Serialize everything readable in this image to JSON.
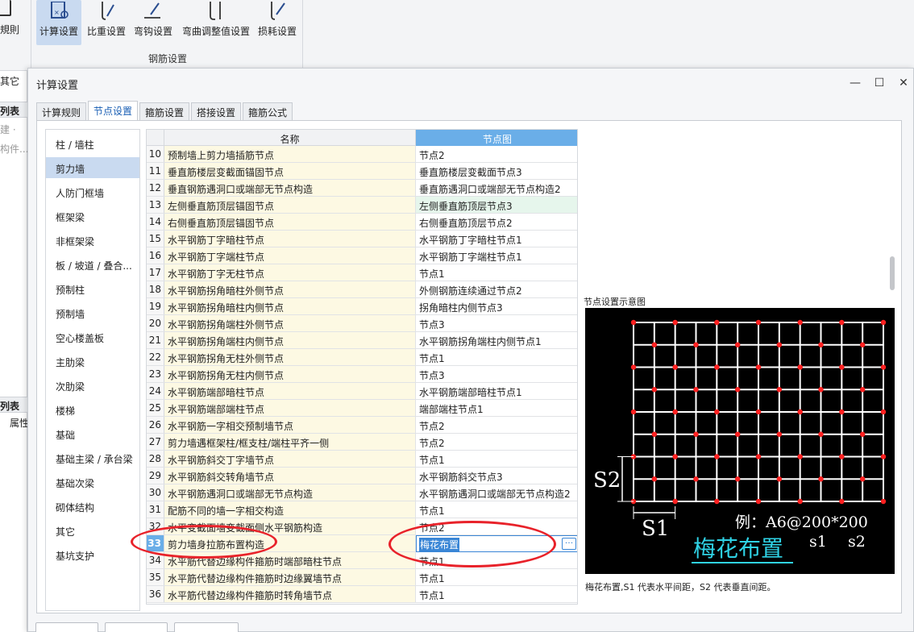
{
  "ribbon": {
    "left_label": "規則",
    "buttons": [
      {
        "label": "计算设置",
        "icon": "calc-settings-icon",
        "active": true
      },
      {
        "label": "比重设置",
        "icon": "rebar-weight-icon"
      },
      {
        "label": "弯钩设置",
        "icon": "hook-icon"
      },
      {
        "label": "弯曲调整值设置",
        "icon": "bend-adjust-icon"
      },
      {
        "label": "损耗设置",
        "icon": "loss-icon"
      }
    ],
    "group_title": "钢筋设置"
  },
  "left_panel": {
    "texts": [
      "其它",
      "列表",
      "建 ·",
      "构件...",
      "列表",
      "属性"
    ]
  },
  "dialog": {
    "title": "计算设置",
    "tabs": [
      "计算规则",
      "节点设置",
      "箍筋设置",
      "搭接设置",
      "箍筋公式"
    ],
    "active_tab": 1,
    "categories": [
      "柱 / 墙柱",
      "剪力墙",
      "人防门框墙",
      "框架梁",
      "非框架梁",
      "板 / 坡道 / 叠合...",
      "预制柱",
      "预制墙",
      "空心楼盖板",
      "主肋梁",
      "次肋梁",
      "楼梯",
      "基础",
      "基础主梁 / 承台梁",
      "基础次梁",
      "砌体结构",
      "其它",
      "基坑支护"
    ],
    "selected_category": 1,
    "grid": {
      "col_name": "名称",
      "col_node": "节点图",
      "rows": [
        {
          "idx": "10",
          "name": "预制墙上剪力墙插筋节点",
          "node": "节点2"
        },
        {
          "idx": "11",
          "name": "垂直筋楼层变截面锚固节点",
          "node": "垂直筋楼层变截面节点3"
        },
        {
          "idx": "12",
          "name": "垂直钢筋遇洞口或端部无节点构造",
          "node": "垂直筋遇洞口或端部无节点构造2"
        },
        {
          "idx": "13",
          "name": "左侧垂直筋顶层锚固节点",
          "node": "左侧垂直筋顶层节点3"
        },
        {
          "idx": "14",
          "name": "右侧垂直筋顶层锚固节点",
          "node": "右侧垂直筋顶层节点2"
        },
        {
          "idx": "15",
          "name": "水平钢筋丁字暗柱节点",
          "node": "水平钢筋丁字暗柱节点1"
        },
        {
          "idx": "16",
          "name": "水平钢筋丁字端柱节点",
          "node": "水平钢筋丁字端柱节点1"
        },
        {
          "idx": "17",
          "name": "水平钢筋丁字无柱节点",
          "node": "节点1"
        },
        {
          "idx": "18",
          "name": "水平钢筋拐角暗柱外侧节点",
          "node": "外侧钢筋连续通过节点2"
        },
        {
          "idx": "19",
          "name": "水平钢筋拐角暗柱内侧节点",
          "node": "拐角暗柱内侧节点3"
        },
        {
          "idx": "20",
          "name": "水平钢筋拐角端柱外侧节点",
          "node": "节点3"
        },
        {
          "idx": "21",
          "name": "水平钢筋拐角端柱内侧节点",
          "node": "水平钢筋拐角端柱内侧节点1"
        },
        {
          "idx": "22",
          "name": "水平钢筋拐角无柱外侧节点",
          "node": "节点1"
        },
        {
          "idx": "23",
          "name": "水平钢筋拐角无柱内侧节点",
          "node": "节点3"
        },
        {
          "idx": "24",
          "name": "水平钢筋端部暗柱节点",
          "node": "水平钢筋端部暗柱节点1"
        },
        {
          "idx": "25",
          "name": "水平钢筋端部端柱节点",
          "node": "端部端柱节点1"
        },
        {
          "idx": "26",
          "name": "水平钢筋一字相交预制墙节点",
          "node": "节点2"
        },
        {
          "idx": "27",
          "name": "剪力墙遇框架柱/框支柱/端柱平齐一侧",
          "node": "节点2"
        },
        {
          "idx": "28",
          "name": "水平钢筋斜交丁字墙节点",
          "node": "节点1"
        },
        {
          "idx": "29",
          "name": "水平钢筋斜交转角墙节点",
          "node": "水平钢筋斜交节点3"
        },
        {
          "idx": "30",
          "name": "水平钢筋遇洞口或端部无节点构造",
          "node": "水平钢筋遇洞口或端部无节点构造2"
        },
        {
          "idx": "31",
          "name": "配筋不同的墙一字相交构造",
          "node": "节点1"
        },
        {
          "idx": "32",
          "name": "水平变截面墙变截面侧水平钢筋构造",
          "node": "节点2"
        },
        {
          "idx": "33",
          "name": "剪力墙身拉筋布置构造",
          "node": "梅花布置"
        },
        {
          "idx": "34",
          "name": "水平筋代替边缘构件箍筋时端部暗柱节点",
          "node": "节点1"
        },
        {
          "idx": "35",
          "name": "水平筋代替边缘构件箍筋时边缘翼墙节点",
          "node": "节点1"
        },
        {
          "idx": "36",
          "name": "水平筋代替边缘构件箍筋时转角墙节点",
          "node": "节点1"
        }
      ],
      "highlight_row": 3,
      "selected_row": 23
    },
    "preview": {
      "title": "节点设置示意图",
      "s2_label": "S2",
      "s1_label": "S1",
      "example": "例：A6@200*200",
      "s1_small": "s1",
      "s2_small": "s2",
      "pattern_name": "梅花布置",
      "caption": "梅花布置,S1 代表水平间距，S2 代表垂直间距。",
      "grid_color": "#ffffff",
      "dot_color": "#ff2020",
      "accent_color": "#2fd3e6"
    }
  }
}
